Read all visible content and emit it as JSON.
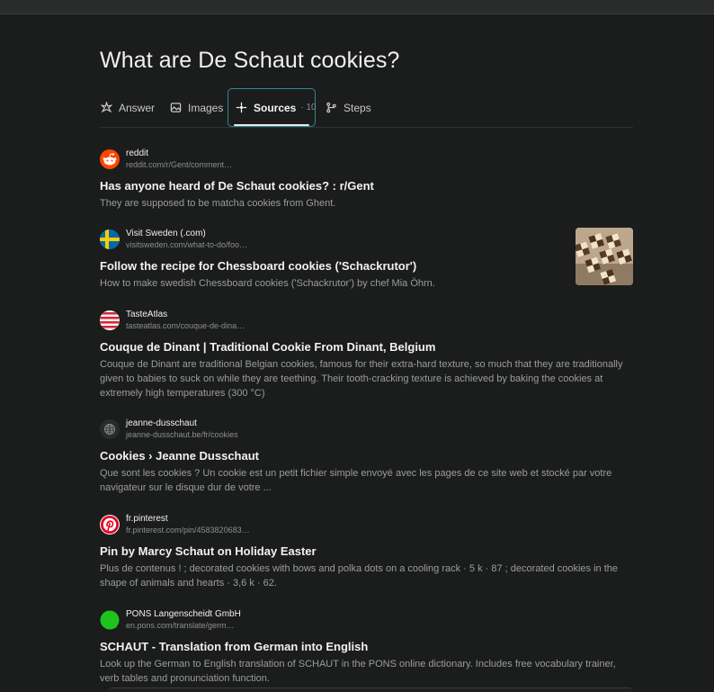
{
  "query": "What are De Schaut cookies?",
  "tabs": {
    "answer": "Answer",
    "images": "Images",
    "sources": "Sources",
    "sources_count": "· 10",
    "steps": "Steps"
  },
  "accent_color": "#2a8a97",
  "results": [
    {
      "source": "reddit",
      "url": "reddit.com/r/Gent/comment…",
      "title": "Has anyone heard of De Schaut cookies? : r/Gent",
      "snippet": "They are supposed to be matcha cookies from Ghent.",
      "icon": "reddit-icon"
    },
    {
      "source": "Visit Sweden (.com)",
      "url": "visitsweden.com/what-to-do/foo…",
      "title": "Follow the recipe for Chessboard cookies ('Schackrutor')",
      "snippet": "How to make swedish Chessboard cookies ('Schackrutor') by chef Mia Öhrn.",
      "icon": "sweden-flag-icon",
      "has_thumbnail": true
    },
    {
      "source": "TasteAtlas",
      "url": "tasteatlas.com/couque-de-dina…",
      "title": "Couque de Dinant | Traditional Cookie From Dinant, Belgium",
      "snippet": "Couque de Dinant are traditional Belgian cookies, famous for their extra-hard texture, so much that they are traditionally given to babies to suck on while they are teething. Their tooth-cracking texture is achieved by baking the cookies at extremely high temperatures (300 °C)",
      "icon": "tasteatlas-icon"
    },
    {
      "source": "jeanne-dusschaut",
      "url": "jeanne-dusschaut.be/fr/cookies",
      "title": "Cookies › Jeanne Dusschaut",
      "snippet": "Que sont les cookies ? Un cookie est un petit fichier simple envoyé avec les pages de ce site web et stocké par votre navigateur sur le disque dur de votre ...",
      "icon": "globe-icon"
    },
    {
      "source": "fr.pinterest",
      "url": "fr.pinterest.com/pin/4583820683…",
      "title": "Pin by Marcy Schaut on Holiday Easter",
      "snippet": "Plus de contenus ! ; decorated cookies with bows and polka dots on a cooling rack · 5 k · 87 ; decorated cookies in the shape of animals and hearts · 3,6 k · 62.",
      "icon": "pinterest-icon"
    },
    {
      "source": "PONS Langenscheidt GmbH",
      "url": "en.pons.com/translate/germ…",
      "title": "SCHAUT - Translation from German into English",
      "snippet": "Look up the German to English translation of SCHAUT in the PONS online dictionary. Includes free vocabulary trainer, verb tables and pronunciation function.",
      "icon": "pons-icon"
    }
  ]
}
